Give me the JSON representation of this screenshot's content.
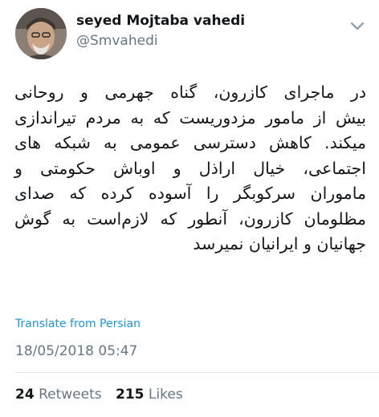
{
  "user": {
    "display_name": "seyed Mojtaba vahedi",
    "handle": "@Smvahedi",
    "avatar_icon": "profile-photo"
  },
  "tweet": {
    "lines": [
      "در ماجرای کازرون، گناه جهرمی و روحانی",
      "بیش از مامور مزدوریست که به مردم تیراندازی",
      "میکند. کاهش دسترسی عمومی  به شبکه های",
      "اجتماعی، خیال اراذل و  اوباش حکومتی و",
      "ماموران سرکوبگر را آسوده کرده که صدای",
      "مظلومان کازرون، آنطور که لازم‌است  به گوش",
      "جهانیان  و ایرانیان نمیرسد"
    ],
    "translate_label": "Translate from Persian",
    "timestamp": "18/05/2018 05:47"
  },
  "stats": {
    "retweets_count": "24",
    "retweets_label": "Retweets",
    "likes_count": "215",
    "likes_label": "Likes"
  },
  "colors": {
    "link": "#1b95e0",
    "secondary": "#657786",
    "text": "#14171a",
    "divider": "#e1e8ed"
  },
  "icons": {
    "menu": "chevron-down-icon"
  }
}
